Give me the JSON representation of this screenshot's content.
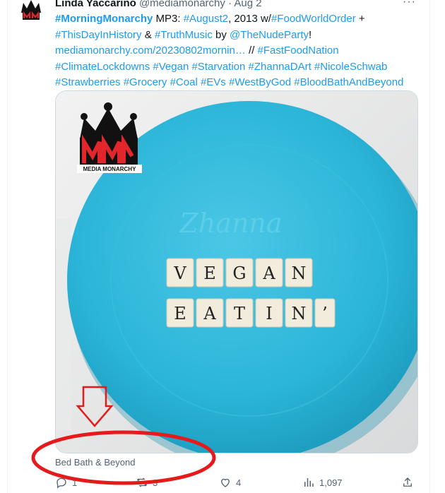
{
  "tweet": {
    "author_name": "Linda Yaccarino",
    "author_handle": "@mediamonarchy",
    "separator": "·",
    "date": "Aug 2",
    "more_label": "···",
    "text": {
      "tag_morningmonarchy": "#MorningMonarchy",
      "mp3": " MP3: ",
      "tag_august2": "#August2",
      "year_w": ", 2013 w/",
      "tag_foodworldorder": "#FoodWorldOrder",
      "plus": " +",
      "tag_thisdayinhistory": "#ThisDayInHistory",
      "amp": " & ",
      "tag_truthmusic": "#TruthMusic",
      "by": " by ",
      "mention_nudeparty": "@TheNudeParty",
      "bang": "!",
      "url": "mediamonarchy.com/20230802mornin…",
      "slashes": " // ",
      "tag_fastfoodnation": "#FastFoodNation",
      "tags_line4": [
        "#ClimateLockdowns",
        "#Vegan",
        "#Starvation",
        "#ZhannaDArt",
        "#NicoleSchwab"
      ],
      "tags_line5": [
        "#Strawberries",
        "#Grocery",
        "#Coal",
        "#EVs",
        "#WestByGod",
        "#BloodBathAndBeyond"
      ]
    },
    "image": {
      "logo_text": "MEDIA MONARCHY",
      "logo_letters": "MM",
      "watermark": "Zhanna",
      "tiles_row1": [
        "V",
        "E",
        "G",
        "A",
        "N"
      ],
      "tiles_row2": [
        "E",
        "A",
        "T",
        "I",
        "N",
        "’"
      ]
    },
    "caption": "Bed Bath & Beyond",
    "stats": {
      "replies": "1",
      "reposts": "3",
      "likes": "4",
      "views": "1,097"
    }
  },
  "colors": {
    "link": "#1d9bf0",
    "muted": "#536471",
    "plate": "#29b6d8",
    "annotation": "#e51a1a"
  }
}
